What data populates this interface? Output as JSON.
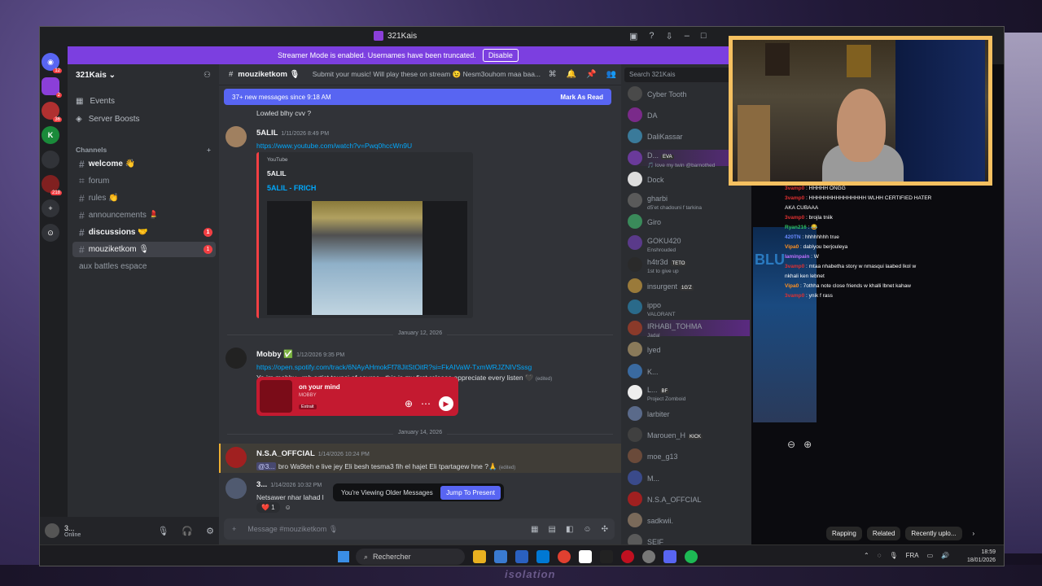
{
  "window": {
    "title": "321Kais"
  },
  "streamer_banner": {
    "text": "Streamer Mode is enabled. Usernames have been truncated.",
    "button": "Disable"
  },
  "guilds": [
    {
      "badge": "12"
    },
    {
      "badge": "2"
    },
    {
      "badge": "36"
    },
    {
      "badge": ""
    },
    {
      "badge": "218"
    }
  ],
  "server": {
    "name": "321Kais ⌄"
  },
  "sidebar": {
    "events": "Events",
    "boosts": "Server Boosts",
    "channels_header": "Channels",
    "channels": [
      {
        "name": "welcome 👋",
        "badge": ""
      },
      {
        "name": "forum",
        "badge": ""
      },
      {
        "name": "rules 👏",
        "badge": ""
      },
      {
        "name": "announcements 💄",
        "badge": ""
      },
      {
        "name": "discussions 🤝",
        "badge": "1"
      },
      {
        "name": "mouziketkom 🎙",
        "badge": "1"
      },
      {
        "name": "aux battles espace",
        "badge": ""
      }
    ]
  },
  "user": {
    "name": "3...",
    "status": "Online"
  },
  "chat": {
    "channel": "mouziketkom 🎙",
    "topic": "Submit your music! Will play these on stream 😉 Nesm3ouhom maa baa...",
    "new_messages": "37+ new messages since 9:18 AM",
    "mark_read": "Mark As Read",
    "prev_text": "Lowled blhy cvv ?",
    "messages": [
      {
        "user": "5ALIL",
        "time": "1/11/2026 8:49 PM",
        "link": "https://www.youtube.com/watch?v=Pwq0hccWn9U",
        "embed": {
          "provider": "YouTube",
          "author": "5ALIL",
          "title": "5ALIL - FRICH"
        }
      },
      {
        "user": "Mobby ✅",
        "time": "1/12/2026 9:35 PM",
        "link": "https://open.spotify.com/track/6NAyAHmokFf78JitStOitR?si=FkAIVaW-TxmWRJZNIVSssg",
        "text": "Yo im mobby , rnb artist tounsi of course , this is my first release appreciate every listen 🖤",
        "edited": "(edited)",
        "spotify": {
          "song": "on your mind",
          "artist": "MOBBY",
          "tag": "Extrait"
        }
      },
      {
        "user": "N.S.A_OFFCIAL",
        "time": "1/14/2026 10:24 PM",
        "mention": "@3...",
        "text": "bro Wa9teh e live jey Eli besh tesma3 fih el hajet Eli tpartagew hne ?🙏",
        "edited": "(edited)"
      },
      {
        "user": "3...",
        "time": "1/14/2026 10:32 PM",
        "text": "Netsawer nhar lahad l",
        "reaction": "❤️ 1"
      }
    ],
    "dividers": [
      "January 12, 2026",
      "January 14, 2026"
    ],
    "older": "You're Viewing Older Messages",
    "jump": "Jump To Present",
    "composer_placeholder": "Message #mouziketkom 🎙"
  },
  "members": {
    "search": "Search 321Kais",
    "list": [
      {
        "name": "Cyber Tooth",
        "status": ""
      },
      {
        "name": "DA",
        "status": ""
      },
      {
        "name": "DaliKassar",
        "status": ""
      },
      {
        "name": "D...",
        "tag": "EVA",
        "status": "🎵 love my twin @barnothed"
      },
      {
        "name": "Dock",
        "status": ""
      },
      {
        "name": "gharbi",
        "status": "d5'et chadouni f tarkina"
      },
      {
        "name": "Giro",
        "status": ""
      },
      {
        "name": "GOKU420",
        "status": "Enshrouded"
      },
      {
        "name": "h4tr3d",
        "tag": "TETO",
        "status": "1st to give up"
      },
      {
        "name": "insurgent",
        "tag": "1G'Z",
        "status": ""
      },
      {
        "name": "ippo",
        "status": "VALORANT"
      },
      {
        "name": "IRHABI_TOHMA",
        "status": "Jadal"
      },
      {
        "name": "lyed",
        "status": ""
      },
      {
        "name": "K...",
        "status": ""
      },
      {
        "name": "L...",
        "tag": "BF",
        "status": "Project Zomboid"
      },
      {
        "name": "larbiter",
        "status": ""
      },
      {
        "name": "Marouen_H",
        "tag": "KICK",
        "status": ""
      },
      {
        "name": "moe_g13",
        "status": ""
      },
      {
        "name": "M...",
        "status": ""
      },
      {
        "name": "N.S.A_OFFCIAL",
        "status": ""
      },
      {
        "name": "sadkwii.",
        "status": ""
      },
      {
        "name": "SEIF",
        "status": ""
      }
    ]
  },
  "stream_chat": [
    {
      "user": "3vamp0",
      "msg": "HHHHH ONGG"
    },
    {
      "user": "3vamp0",
      "msg": "HHHHHHHHHHHHHHH WLHH CERTIFIED HATER"
    },
    {
      "user": "",
      "msg": "AKA CUBAAA"
    },
    {
      "user": "3vamp0",
      "msg": "brojla tniik"
    },
    {
      "user": "Ryan216",
      "msg": "😂"
    },
    {
      "user": "420TN",
      "msg": "hhhhhhhh true"
    },
    {
      "user": "Vipa0",
      "msg": "dablyou berjouleya"
    },
    {
      "user": "Iaminpain",
      "msg": "W"
    },
    {
      "user": "3vamp0",
      "msg": "mtaa nhabetha story w nmasqui laabed lkol w"
    },
    {
      "user": "",
      "msg": "nkhali ken lebnet"
    },
    {
      "user": "Vipa0",
      "msg": "7othha note close friends w khalli lbnet kahaw"
    },
    {
      "user": "3vamp0",
      "msg": "ynik f rass"
    }
  ],
  "youtube_pane": {
    "overlay_text": "BLU",
    "pills": [
      "Rapping",
      "Related",
      "Recently uplo..."
    ]
  },
  "taskbar": {
    "search": "Rechercher",
    "lang": "FRA",
    "time": "18:59",
    "date": "18/01/2026"
  },
  "bottom_brand": "isolation"
}
